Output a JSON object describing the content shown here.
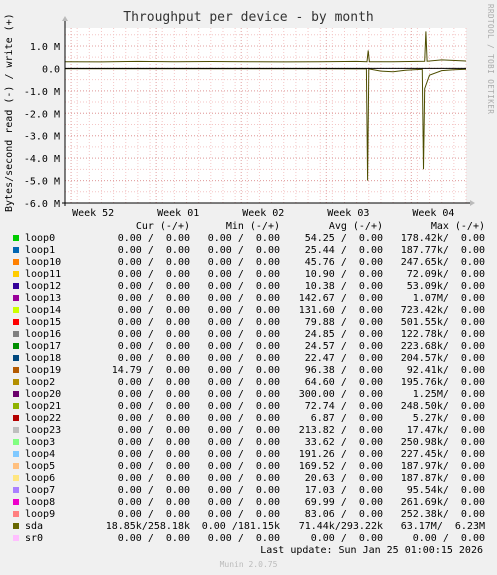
{
  "chart_data": {
    "type": "line",
    "title": "Throughput per device - by month",
    "ylabel": "Bytes/second read (-) / write (+)",
    "watermark": "RRDTOOL / TOBI OETIKER",
    "yticks": [
      "1.0 M",
      "0.0",
      "-1.0 M",
      "-2.0 M",
      "-3.0 M",
      "-4.0 M",
      "-5.0 M",
      "-6.0 M"
    ],
    "ytick_values": [
      1000000,
      0,
      -1000000,
      -2000000,
      -3000000,
      -4000000,
      -5000000,
      -6000000
    ],
    "ylim": [
      -6000000,
      1800000
    ],
    "xticks": [
      "Week 52",
      "Week 01",
      "Week 02",
      "Week 03",
      "Week 04"
    ],
    "xtick_values": [
      0.5,
      7.5,
      14.5,
      21.5,
      28.5
    ],
    "xlim": [
      0,
      33
    ],
    "grid": true,
    "series": [
      {
        "name": "sda",
        "color": "#4d4d00",
        "write": [
          [
            0,
            300000
          ],
          [
            3,
            290000
          ],
          [
            6,
            310000
          ],
          [
            9,
            295000
          ],
          [
            12,
            305000
          ],
          [
            15,
            300000
          ],
          [
            18,
            290000
          ],
          [
            21,
            300000
          ],
          [
            24,
            310000
          ],
          [
            24.85,
            300000
          ],
          [
            24.95,
            800000
          ],
          [
            25.05,
            300000
          ],
          [
            27,
            300000
          ],
          [
            29.6,
            320000
          ],
          [
            29.7,
            1650000
          ],
          [
            29.8,
            320000
          ],
          [
            31,
            380000
          ],
          [
            33,
            330000
          ]
        ],
        "read": [
          [
            0,
            -20000
          ],
          [
            3,
            -20000
          ],
          [
            6,
            -15000
          ],
          [
            9,
            -20000
          ],
          [
            12,
            -20000
          ],
          [
            15,
            -20000
          ],
          [
            18,
            -20000
          ],
          [
            21,
            -20000
          ],
          [
            24,
            -25000
          ],
          [
            24.8,
            -25000
          ],
          [
            24.9,
            -5000000
          ],
          [
            25.0,
            -25000
          ],
          [
            26,
            -120000
          ],
          [
            27,
            -150000
          ],
          [
            28,
            -80000
          ],
          [
            29.4,
            -40000
          ],
          [
            29.5,
            -4500000
          ],
          [
            29.6,
            -900000
          ],
          [
            30,
            -300000
          ],
          [
            31,
            -100000
          ],
          [
            32,
            -60000
          ],
          [
            33,
            -40000
          ]
        ]
      }
    ],
    "legend_headers": [
      "Cur (-/+)",
      "Min (-/+)",
      "Avg (-/+)",
      "Max (-/+)"
    ],
    "rows": [
      {
        "name": "loop0",
        "color": "#00cc00",
        "cur": "0.00 /  0.00",
        "min": "0.00 /  0.00",
        "avg": "54.25 /  0.00",
        "max": "178.42k/  0.00"
      },
      {
        "name": "loop1",
        "color": "#0066b3",
        "cur": "0.00 /  0.00",
        "min": "0.00 /  0.00",
        "avg": "25.44 /  0.00",
        "max": "187.77k/  0.00"
      },
      {
        "name": "loop10",
        "color": "#ff8000",
        "cur": "0.00 /  0.00",
        "min": "0.00 /  0.00",
        "avg": "45.76 /  0.00",
        "max": "247.65k/  0.00"
      },
      {
        "name": "loop11",
        "color": "#ffcc00",
        "cur": "0.00 /  0.00",
        "min": "0.00 /  0.00",
        "avg": "10.90 /  0.00",
        "max": "72.09k/  0.00"
      },
      {
        "name": "loop12",
        "color": "#330099",
        "cur": "0.00 /  0.00",
        "min": "0.00 /  0.00",
        "avg": "10.38 /  0.00",
        "max": "53.09k/  0.00"
      },
      {
        "name": "loop13",
        "color": "#990099",
        "cur": "0.00 /  0.00",
        "min": "0.00 /  0.00",
        "avg": "142.67 /  0.00",
        "max": "1.07M/  0.00"
      },
      {
        "name": "loop14",
        "color": "#ccff00",
        "cur": "0.00 /  0.00",
        "min": "0.00 /  0.00",
        "avg": "131.60 /  0.00",
        "max": "723.42k/  0.00"
      },
      {
        "name": "loop15",
        "color": "#ff0000",
        "cur": "0.00 /  0.00",
        "min": "0.00 /  0.00",
        "avg": "79.88 /  0.00",
        "max": "501.55k/  0.00"
      },
      {
        "name": "loop16",
        "color": "#808080",
        "cur": "0.00 /  0.00",
        "min": "0.00 /  0.00",
        "avg": "24.85 /  0.00",
        "max": "122.78k/  0.00"
      },
      {
        "name": "loop17",
        "color": "#008f00",
        "cur": "0.00 /  0.00",
        "min": "0.00 /  0.00",
        "avg": "24.57 /  0.00",
        "max": "223.68k/  0.00"
      },
      {
        "name": "loop18",
        "color": "#00487d",
        "cur": "0.00 /  0.00",
        "min": "0.00 /  0.00",
        "avg": "22.47 /  0.00",
        "max": "204.57k/  0.00"
      },
      {
        "name": "loop19",
        "color": "#b35a00",
        "cur": "14.79 /  0.00",
        "min": "0.00 /  0.00",
        "avg": "96.38 /  0.00",
        "max": "92.41k/  0.00"
      },
      {
        "name": "loop2",
        "color": "#b38f00",
        "cur": "0.00 /  0.00",
        "min": "0.00 /  0.00",
        "avg": "64.60 /  0.00",
        "max": "195.76k/  0.00"
      },
      {
        "name": "loop20",
        "color": "#6b006b",
        "cur": "0.00 /  0.00",
        "min": "0.00 /  0.00",
        "avg": "300.00 /  0.00",
        "max": "1.25M/  0.00"
      },
      {
        "name": "loop21",
        "color": "#8fb300",
        "cur": "0.00 /  0.00",
        "min": "0.00 /  0.00",
        "avg": "72.74 /  0.00",
        "max": "248.50k/  0.00"
      },
      {
        "name": "loop22",
        "color": "#b30000",
        "cur": "0.00 /  0.00",
        "min": "0.00 /  0.00",
        "avg": "6.87 /  0.00",
        "max": "5.27k/  0.00"
      },
      {
        "name": "loop23",
        "color": "#bebebe",
        "cur": "0.00 /  0.00",
        "min": "0.00 /  0.00",
        "avg": "213.82 /  0.00",
        "max": "17.47k/  0.00"
      },
      {
        "name": "loop3",
        "color": "#80ff80",
        "cur": "0.00 /  0.00",
        "min": "0.00 /  0.00",
        "avg": "33.62 /  0.00",
        "max": "250.98k/  0.00"
      },
      {
        "name": "loop4",
        "color": "#80c9ff",
        "cur": "0.00 /  0.00",
        "min": "0.00 /  0.00",
        "avg": "191.26 /  0.00",
        "max": "227.45k/  0.00"
      },
      {
        "name": "loop5",
        "color": "#ffc080",
        "cur": "0.00 /  0.00",
        "min": "0.00 /  0.00",
        "avg": "169.52 /  0.00",
        "max": "187.97k/  0.00"
      },
      {
        "name": "loop6",
        "color": "#ffe680",
        "cur": "0.00 /  0.00",
        "min": "0.00 /  0.00",
        "avg": "20.63 /  0.00",
        "max": "187.87k/  0.00"
      },
      {
        "name": "loop7",
        "color": "#aa80ff",
        "cur": "0.00 /  0.00",
        "min": "0.00 /  0.00",
        "avg": "17.03 /  0.00",
        "max": "95.54k/  0.00"
      },
      {
        "name": "loop8",
        "color": "#ee00cc",
        "cur": "0.00 /  0.00",
        "min": "0.00 /  0.00",
        "avg": "69.99 /  0.00",
        "max": "261.69k/  0.00"
      },
      {
        "name": "loop9",
        "color": "#ff8080",
        "cur": "0.00 /  0.00",
        "min": "0.00 /  0.00",
        "avg": "83.06 /  0.00",
        "max": "252.38k/  0.00"
      },
      {
        "name": "sda",
        "color": "#666600",
        "cur": "18.85k/258.18k",
        "min": "0.00 /181.15k",
        "avg": "71.44k/293.22k",
        "max": "63.17M/  6.23M"
      },
      {
        "name": "sr0",
        "color": "#ffbfff",
        "cur": "0.00 /  0.00",
        "min": "0.00 /  0.00",
        "avg": "0.00 /  0.00",
        "max": "0.00 /  0.00"
      }
    ],
    "last_update": "Last update: Sun Jan 25 01:00:15 2026",
    "version": "Munin 2.0.75"
  }
}
